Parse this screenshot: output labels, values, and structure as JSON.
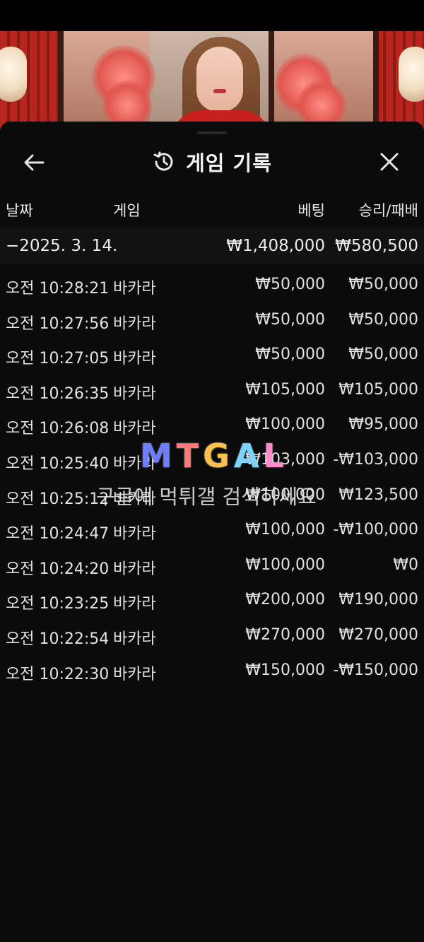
{
  "header": {
    "title": "게임 기록",
    "back_icon": "arrow-left-icon",
    "history_icon": "history-clock-icon",
    "close_icon": "close-x-icon"
  },
  "columns": {
    "date": "날짜",
    "game": "게임",
    "bet": "베팅",
    "result": "승리/패배"
  },
  "date_group": {
    "date": "−2025. 3. 14.",
    "bet_total": "₩1,408,000",
    "result_total": "₩580,500"
  },
  "rows": [
    {
      "time": "오전 10:28:21",
      "game": "바카라",
      "bet": "₩50,000",
      "result": "₩50,000"
    },
    {
      "time": "오전 10:27:56",
      "game": "바카라",
      "bet": "₩50,000",
      "result": "₩50,000"
    },
    {
      "time": "오전 10:27:05",
      "game": "바카라",
      "bet": "₩50,000",
      "result": "₩50,000"
    },
    {
      "time": "오전 10:26:35",
      "game": "바카라",
      "bet": "₩105,000",
      "result": "₩105,000"
    },
    {
      "time": "오전 10:26:08",
      "game": "바카라",
      "bet": "₩100,000",
      "result": "₩95,000"
    },
    {
      "time": "오전 10:25:40",
      "game": "바카라",
      "bet": "₩103,000",
      "result": "-₩103,000"
    },
    {
      "time": "오전 10:25:12",
      "game": "바카라",
      "bet": "₩100,000",
      "result": "₩123,500"
    },
    {
      "time": "오전 10:24:47",
      "game": "바카라",
      "bet": "₩100,000",
      "result": "-₩100,000"
    },
    {
      "time": "오전 10:24:20",
      "game": "바카라",
      "bet": "₩100,000",
      "result": "₩0"
    },
    {
      "time": "오전 10:23:25",
      "game": "바카라",
      "bet": "₩200,000",
      "result": "₩190,000"
    },
    {
      "time": "오전 10:22:54",
      "game": "바카라",
      "bet": "₩270,000",
      "result": "₩270,000"
    },
    {
      "time": "오전 10:22:30",
      "game": "바카라",
      "bet": "₩150,000",
      "result": "-₩150,000"
    }
  ],
  "watermark": {
    "logo_letters": [
      "M",
      "T",
      "G",
      "A",
      "L"
    ],
    "logo_colors": [
      "#6f7dff",
      "#ff7a7a",
      "#ffc04d",
      "#7ad4ff",
      "#ff8ec8"
    ],
    "tagline": "구글에 먹튀갤 검색하세요"
  },
  "colors": {
    "panel_bg": "#0b0b0b",
    "text": "#e2e2e2"
  }
}
